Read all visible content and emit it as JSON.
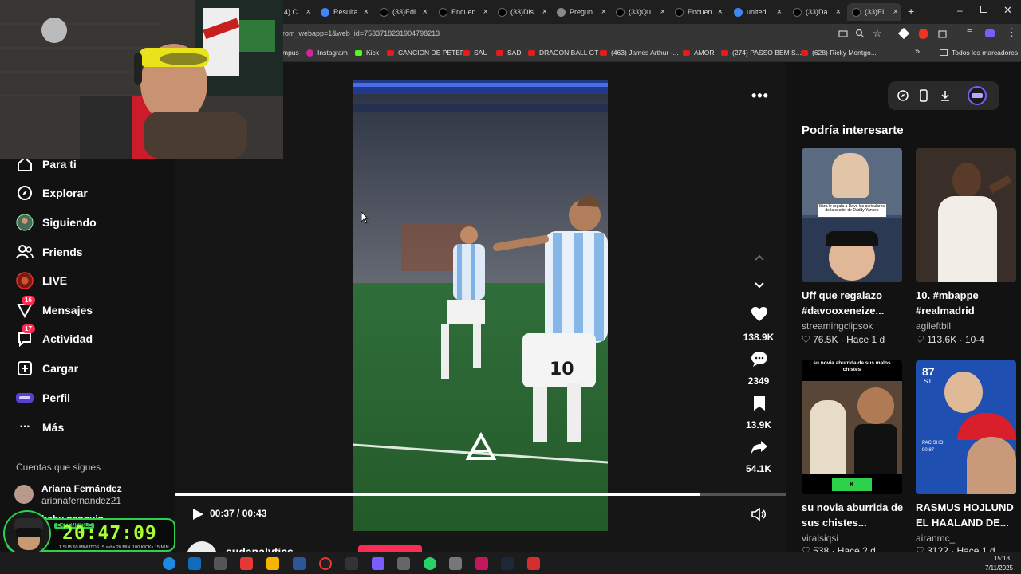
{
  "browser": {
    "tabs": [
      {
        "label": "4) C"
      },
      {
        "label": "Resulta"
      },
      {
        "label": "(33)Edi"
      },
      {
        "label": "Encuen"
      },
      {
        "label": "(33)Dis"
      },
      {
        "label": "Pregun"
      },
      {
        "label": "(33)Qu"
      },
      {
        "label": "Encuen"
      },
      {
        "label": "united"
      },
      {
        "label": "(33)Da"
      },
      {
        "label": "(33)EL"
      }
    ],
    "url": "rom_webapp=1&web_id=7533718231904798213",
    "bookmarks": [
      "mpus",
      "Instagram",
      "Kick",
      "CANCION DE PETER",
      "SAU",
      "SAD",
      "DRAGON BALL GT",
      "(463) James Arthur -...",
      "AMOR",
      "(274) PASSO BEM S...",
      "(628) Ricky Montgo..."
    ],
    "bookmarks_more": "»",
    "all_bookmarks": "Todos los marcadores"
  },
  "sidebar": {
    "items": [
      {
        "label": "Para ti"
      },
      {
        "label": "Explorar"
      },
      {
        "label": "Siguiendo"
      },
      {
        "label": "Friends"
      },
      {
        "label": "LIVE"
      },
      {
        "label": "Mensajes",
        "badge": "16"
      },
      {
        "label": "Actividad",
        "badge": "17"
      },
      {
        "label": "Cargar"
      },
      {
        "label": "Perfil"
      },
      {
        "label": "Más"
      }
    ],
    "following_heading": "Cuentas que sigues",
    "following": [
      {
        "name": "Ariana Fernández",
        "handle": "arianafernandez21"
      },
      {
        "name": "baby penguin"
      }
    ]
  },
  "stream_overlay": {
    "label": "EXTENSIBLE",
    "timer": "20:47:09",
    "stats": [
      "1 SUB 60 MINUTOS",
      "5 subs 20 MIN",
      "100 KICKs 15 MIN"
    ]
  },
  "video": {
    "watermark": "A",
    "jersey_number": "10",
    "current_time": "00:37",
    "total_time": "00:43",
    "time_sep": " / ",
    "progress": 0.86,
    "author": "sudanalytics",
    "actions": {
      "likes": "138.9K",
      "comments": "2349",
      "saves": "13.9K",
      "shares": "54.1K"
    }
  },
  "recommendations": {
    "heading": "Podría interesarte",
    "cards": [
      {
        "title_line1": "Uff que regalazo",
        "title_line2": "#davooxeneize...",
        "author": "streamingclipsok",
        "likes": "76.5K",
        "date": "Hace 1 d",
        "thumb_caption": "Ibiza le regala a Davo los auriculares de la sesión de Daddy Yankee"
      },
      {
        "title_line1": "10. #mbappe",
        "title_line2": "#realmadrid",
        "author": "agileftbll",
        "likes": "113.6K",
        "date": "10-4"
      },
      {
        "title_line1": "su novia aburrida de",
        "title_line2": "sus chistes...",
        "author": "viralsiqsi",
        "likes": "538",
        "date": "Hace 2 d",
        "thumb_caption": "su novia aburrida de sus malos chistes"
      },
      {
        "title_line1": "RASMUS HOJLUND",
        "title_line2": "EL HAALAND DE...",
        "author": "airanmc_",
        "likes": "3122",
        "date": "Hace 1 d",
        "card_rating": "87",
        "card_pos": "ST"
      }
    ]
  },
  "clock": {
    "time": "15:13",
    "date": "7/11/2025"
  },
  "colors": {
    "accent": "#fe2c55",
    "background": "#121212",
    "timer_green": "#a6ff2e"
  }
}
